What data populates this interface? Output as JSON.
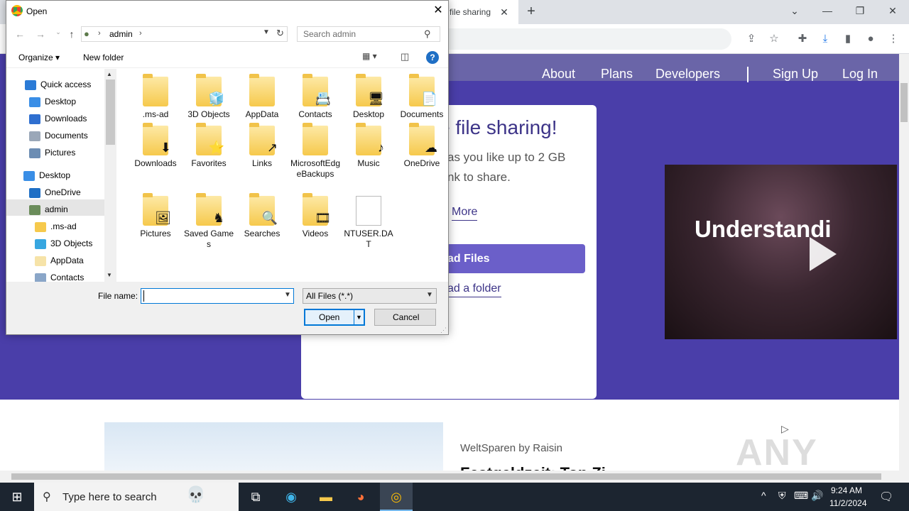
{
  "browser": {
    "tab_title": "file sharing",
    "tab_close": "✕",
    "new_tab": "+",
    "window_controls": [
      "⌄",
      "—",
      "❐",
      "✕"
    ]
  },
  "website": {
    "nav": [
      "About",
      "Plans",
      "Developers",
      "Sign Up",
      "Log In"
    ],
    "hero_title": "e file sharing!",
    "hero_text_1": "as you like up to 2 GB",
    "hero_text_2": "nk to share.",
    "learn_more": "More",
    "upload_files": "ad Files",
    "upload_folder": "ad a folder",
    "video_caption": "Understandi",
    "ad_source": "WeltSparen by Raisin",
    "ad_headline": "Festgeldzeit: Top Zi",
    "watermark": "ANY RUN"
  },
  "dialog": {
    "title": "Open",
    "close": "✕",
    "address_path": "admin",
    "search_placeholder": "Search admin",
    "organize": "Organize ▾",
    "new_folder": "New folder",
    "help": "?",
    "nav_items": [
      {
        "label": "Quick access",
        "icon": "star-icon",
        "color": "#2b7bd6",
        "pin": ""
      },
      {
        "label": "Desktop",
        "icon": "desktop-icon",
        "color": "#3a8ee6",
        "pin": "📌"
      },
      {
        "label": "Downloads",
        "icon": "download-icon",
        "color": "#2f6fd0",
        "pin": "📌"
      },
      {
        "label": "Documents",
        "icon": "documents-icon",
        "color": "#9aa7b8",
        "pin": "📌"
      },
      {
        "label": "Pictures",
        "icon": "pictures-icon",
        "color": "#6c8db3",
        "pin": "📌"
      },
      {
        "label": "Desktop",
        "icon": "desktop-icon",
        "color": "#3a8ee6",
        "pin": ""
      },
      {
        "label": "OneDrive",
        "icon": "cloud-icon",
        "color": "#1f6fc5",
        "pin": ""
      },
      {
        "label": "admin",
        "icon": "user-icon",
        "color": "#6a8c5a",
        "pin": ""
      },
      {
        "label": ".ms-ad",
        "icon": "folder-icon",
        "color": "#f6c94c",
        "pin": ""
      },
      {
        "label": "3D Objects",
        "icon": "cube-icon",
        "color": "#37a6e0",
        "pin": ""
      },
      {
        "label": "AppData",
        "icon": "folder-icon",
        "color": "#f6e3a8",
        "pin": ""
      },
      {
        "label": "Contacts",
        "icon": "contacts-icon",
        "color": "#8aa6c8",
        "pin": ""
      }
    ],
    "files": [
      {
        "name": ".ms-ad",
        "type": "folder",
        "badge": ""
      },
      {
        "name": "3D Objects",
        "type": "folder",
        "badge": "🧊"
      },
      {
        "name": "AppData",
        "type": "folder",
        "badge": ""
      },
      {
        "name": "Contacts",
        "type": "folder",
        "badge": "📇"
      },
      {
        "name": "Desktop",
        "type": "folder",
        "badge": "🖥"
      },
      {
        "name": "Documents",
        "type": "folder",
        "badge": "📄"
      },
      {
        "name": "Downloads",
        "type": "folder",
        "badge": "⬇"
      },
      {
        "name": "Favorites",
        "type": "folder",
        "badge": "⭐"
      },
      {
        "name": "Links",
        "type": "folder",
        "badge": "↗"
      },
      {
        "name": "MicrosoftEdgeBackups",
        "type": "folder",
        "badge": ""
      },
      {
        "name": "Music",
        "type": "folder",
        "badge": "♪"
      },
      {
        "name": "OneDrive",
        "type": "folder",
        "badge": "☁"
      },
      {
        "name": "Pictures",
        "type": "folder",
        "badge": "🖼"
      },
      {
        "name": "Saved Games",
        "type": "folder",
        "badge": "♞"
      },
      {
        "name": "Searches",
        "type": "folder",
        "badge": "🔍"
      },
      {
        "name": "Videos",
        "type": "folder",
        "badge": "🎞"
      },
      {
        "name": "NTUSER.DAT",
        "type": "file",
        "badge": ""
      }
    ],
    "file_name_label": "File name:",
    "file_name_value": "",
    "file_type": "All Files (*.*)",
    "open_label": "Open",
    "cancel_label": "Cancel"
  },
  "taskbar": {
    "search_placeholder": "Type here to search",
    "time": "9:24 AM",
    "date": "11/2/2024"
  }
}
